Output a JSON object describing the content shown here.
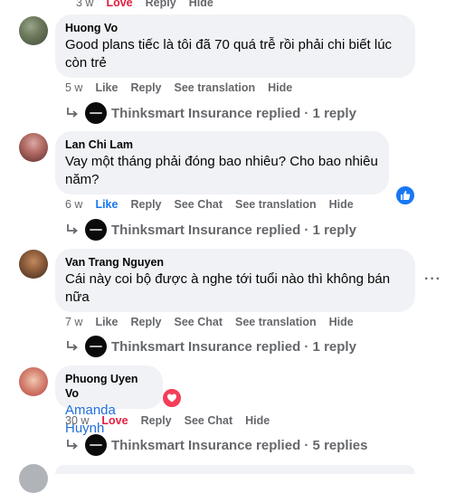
{
  "top_partial": {
    "time": "3 w",
    "love": "Love",
    "reply": "Reply",
    "hide": "Hide"
  },
  "comments": [
    {
      "name": "Huong Vo",
      "text_lines": [
        "Good plans tiếc là tôi đã 70 quá trễ rồi phải chi biết lúc",
        "còn trẻ"
      ],
      "actions": {
        "time": "5 w",
        "like": "Like",
        "reply": "Reply",
        "translate": "See translation",
        "hide": "Hide"
      },
      "replies": "Thinksmart Insurance replied · 1 reply"
    },
    {
      "name": "Lan Chi Lam",
      "text_lines": [
        "Vay một tháng phải đóng bao nhiêu? Cho bao nhiêu",
        "năm?"
      ],
      "actions": {
        "time": "6 w",
        "like": "Like",
        "reply": "Reply",
        "see_chat": "See Chat",
        "translate": "See translation",
        "hide": "Hide"
      },
      "reaction": "like-icon",
      "replies": "Thinksmart Insurance replied · 1 reply"
    },
    {
      "name": "Van Trang Nguyen",
      "text_lines": [
        "Cái này coi bộ được à nghe tới tuổi nào thì không bán",
        "nữa"
      ],
      "actions": {
        "time": "7 w",
        "like": "Like",
        "reply": "Reply",
        "see_chat": "See Chat",
        "translate": "See translation",
        "hide": "Hide"
      },
      "more": "···",
      "replies": "Thinksmart Insurance replied · 1 reply"
    },
    {
      "name": "Phuong Uyen Vo",
      "mention": "Amanda Huynh",
      "actions": {
        "time": "30 w",
        "love": "Love",
        "reply": "Reply",
        "see_chat": "See Chat",
        "hide": "Hide"
      },
      "reaction": "heart-icon",
      "replies": "Thinksmart Insurance replied · 5 replies"
    }
  ],
  "colors": {
    "link_blue": "#216fdb",
    "love_red": "#e41e3f",
    "like_blue": "#1877f2",
    "bubble_bg": "#f0f2f5",
    "meta_grey": "#65676b"
  }
}
